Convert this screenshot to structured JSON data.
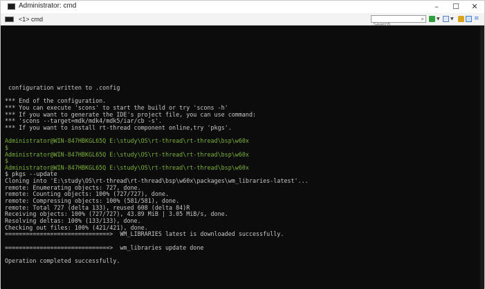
{
  "window": {
    "title": "Administrator: cmd",
    "controls": {
      "minimize": "–",
      "maximize": "☐",
      "close": "✕"
    }
  },
  "tabs": [
    {
      "label": "<1> cmd"
    }
  ],
  "toolbar": {
    "search_placeholder": "Search",
    "search_icon": "magnifier-icon",
    "buttons": [
      {
        "name": "new-console-button",
        "icon": "plus-icon",
        "color": "#2e9e3e"
      },
      {
        "name": "console-list-button",
        "icon": "window-icon",
        "color": "#5b7fb8"
      },
      {
        "name": "lock-button",
        "icon": "lock-icon",
        "color": "#d9a31a"
      },
      {
        "name": "layout-button",
        "icon": "panels-icon",
        "color": "#3b7fd4"
      },
      {
        "name": "menu-button",
        "icon": "menu-icon",
        "color": "#3b7fd4"
      }
    ]
  },
  "console": {
    "lines": [
      {
        "text": " configuration written to .config",
        "color": "default"
      },
      {
        "text": "",
        "color": "default"
      },
      {
        "text": "*** End of the configuration.",
        "color": "default"
      },
      {
        "text": "*** You can execute 'scons' to start the build or try 'scons -h'",
        "color": "default"
      },
      {
        "text": "*** If you want to generate the IDE's project file, you can use command:",
        "color": "default"
      },
      {
        "text": "*** 'scons --target=mdk/mdk4/mdk5/iar/cb -s'.",
        "color": "default"
      },
      {
        "text": "*** If you want to install rt-thread component online,try 'pkgs'.",
        "color": "default"
      },
      {
        "text": "",
        "color": "default"
      },
      {
        "text": "Administrator@WIN-847HBKGL65Q E:\\study\\OS\\rt-thread\\rt-thread\\bsp\\w60x",
        "color": "prompt"
      },
      {
        "text": "$",
        "color": "prompt"
      },
      {
        "text": "Administrator@WIN-847HBKGL65Q E:\\study\\OS\\rt-thread\\rt-thread\\bsp\\w60x",
        "color": "prompt"
      },
      {
        "text": "$",
        "color": "prompt"
      },
      {
        "text": "Administrator@WIN-847HBKGL65Q E:\\study\\OS\\rt-thread\\rt-thread\\bsp\\w60x",
        "color": "prompt"
      },
      {
        "text": "$ pkgs --update",
        "color": "default"
      },
      {
        "text": "Cloning into 'E:\\study\\OS\\rt-thread\\rt-thread\\bsp\\w60x\\packages\\wm_libraries-latest'...",
        "color": "default"
      },
      {
        "text": "remote: Enumerating objects: 727, done.",
        "color": "default"
      },
      {
        "text": "remote: Counting objects: 100% (727/727), done.",
        "color": "default"
      },
      {
        "text": "remote: Compressing objects: 100% (581/581), done.",
        "color": "default"
      },
      {
        "text": "remote: Total 727 (delta 133), reused 608 (delta 84)R",
        "color": "default"
      },
      {
        "text": "Receiving objects: 100% (727/727), 43.89 MiB | 3.05 MiB/s, done.",
        "color": "default"
      },
      {
        "text": "Resolving deltas: 100% (133/133), done.",
        "color": "default"
      },
      {
        "text": "Checking out files: 100% (421/421), done.",
        "color": "default"
      },
      {
        "text": "==============================>  WM_LIBRARIES latest is downloaded successfully.",
        "color": "default"
      },
      {
        "text": "",
        "color": "default"
      },
      {
        "text": "==============================>  wm_libraries update done",
        "color": "default"
      },
      {
        "text": "",
        "color": "default"
      },
      {
        "text": "Operation completed successfully.",
        "color": "default"
      }
    ]
  },
  "colors": {
    "console_bg": "#0c0c0c",
    "text": "#c8c8c8",
    "prompt": "#7bb23a"
  }
}
